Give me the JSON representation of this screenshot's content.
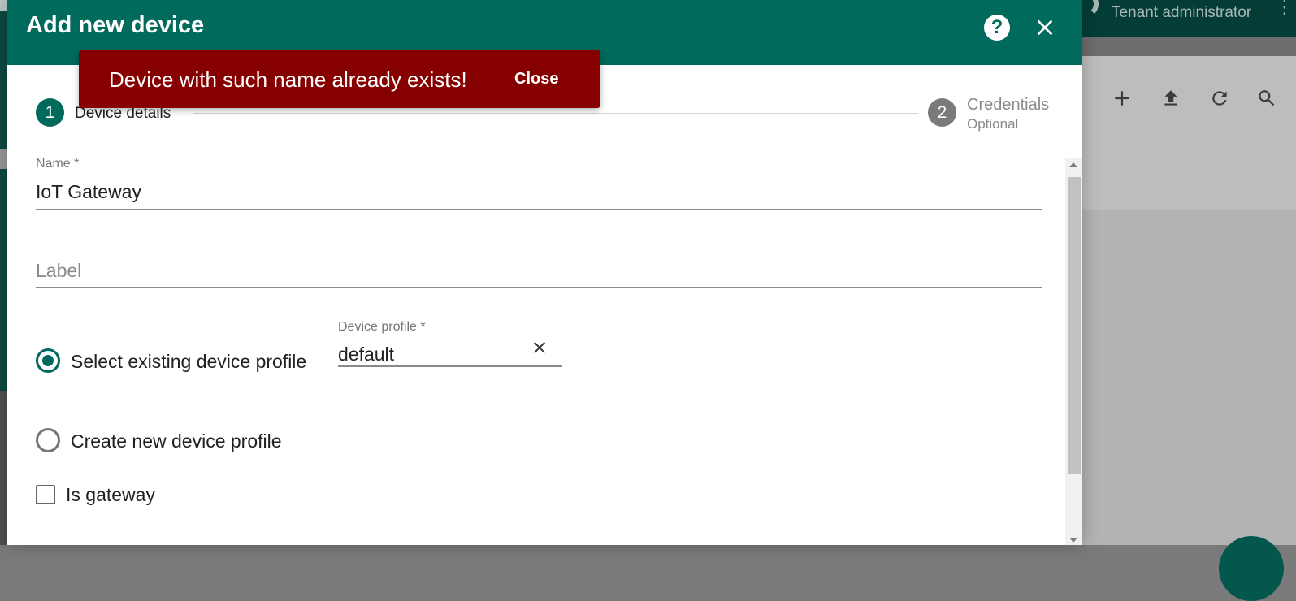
{
  "background": {
    "user_role": "Tenant administrator",
    "menu_icon": "more-vert-icon",
    "toolbar_icons": [
      "add-icon",
      "upload-icon",
      "refresh-icon",
      "search-icon"
    ]
  },
  "dialog": {
    "title": "Add new device",
    "help_icon": "help-icon",
    "close_icon": "close-icon"
  },
  "stepper": {
    "steps": [
      {
        "number": "1",
        "label": "Device details",
        "active": true
      },
      {
        "number": "2",
        "label": "Credentials",
        "sublabel": "Optional",
        "active": false
      }
    ]
  },
  "toast": {
    "message": "Device with such name already exists!",
    "action": "Close"
  },
  "form": {
    "name": {
      "label": "Name *",
      "value": "IoT Gateway"
    },
    "label_field": {
      "placeholder": "Label"
    },
    "profile_options": [
      {
        "label": "Select existing device profile",
        "checked": true
      },
      {
        "label": "Create new device profile",
        "checked": false
      }
    ],
    "device_profile": {
      "label": "Device profile *",
      "value": "default"
    },
    "is_gateway": {
      "label": "Is gateway",
      "checked": false
    }
  },
  "colors": {
    "primary": "#006a5c",
    "error_toast": "#870000"
  }
}
